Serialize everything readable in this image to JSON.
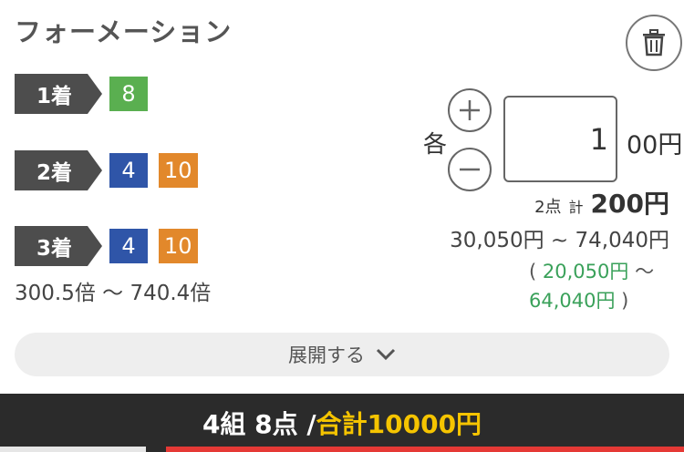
{
  "header": {
    "title": "フォーメーション"
  },
  "icons": {
    "delete": "trash-icon",
    "increment": "plus-icon",
    "decrement": "minus-icon",
    "expand": "chevron-down-icon"
  },
  "colors": {
    "chip_green": "#5aaf50",
    "chip_blue": "#2f55a8",
    "chip_orange": "#e2882b",
    "tag_bg": "#4d4d4d",
    "accent_yellow": "#f5c400",
    "payout_green": "#3aa15a"
  },
  "places": [
    {
      "label": "1着",
      "chips": [
        {
          "num": "8",
          "color": "green"
        }
      ]
    },
    {
      "label": "2着",
      "chips": [
        {
          "num": "4",
          "color": "blue"
        },
        {
          "num": "10",
          "color": "orange"
        }
      ]
    },
    {
      "label": "3着",
      "chips": [
        {
          "num": "4",
          "color": "blue"
        },
        {
          "num": "10",
          "color": "orange"
        }
      ]
    }
  ],
  "odds_range": "300.5倍 〜 740.4倍",
  "bet": {
    "each_label": "各",
    "amount": "1",
    "unit": "00円",
    "points_label": "2点",
    "total_label": "計",
    "total_value": "200円",
    "payout_range": "30,050円 ~ 74,040円",
    "profit_open": "(",
    "profit_min": "20,050円",
    "profit_sep": "〜",
    "profit_max": "64,040円",
    "profit_close": ")"
  },
  "expand": {
    "label": "展開する"
  },
  "footer": {
    "summary": "4組 8点 /",
    "total": "合計10000円"
  }
}
